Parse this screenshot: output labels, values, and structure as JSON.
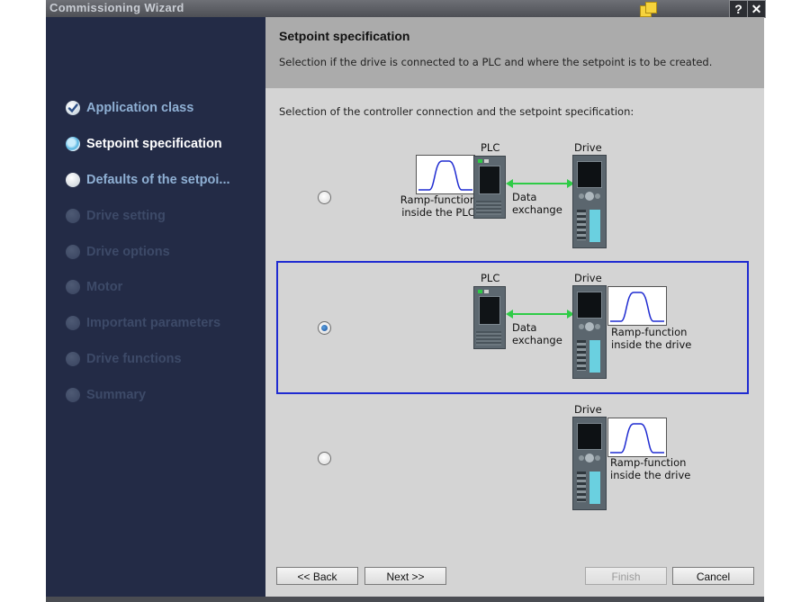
{
  "window": {
    "title": "Commissioning Wizard",
    "help_label": "?",
    "close_label": "✕"
  },
  "steps": [
    {
      "label": "Application class",
      "state": "done"
    },
    {
      "label": "Setpoint specification",
      "state": "current"
    },
    {
      "label": "Defaults of the setpoi...",
      "state": "next"
    },
    {
      "label": "Drive setting",
      "state": "disabled"
    },
    {
      "label": "Drive options",
      "state": "disabled"
    },
    {
      "label": "Motor",
      "state": "disabled"
    },
    {
      "label": "Important parameters",
      "state": "disabled"
    },
    {
      "label": "Drive functions",
      "state": "disabled"
    },
    {
      "label": "Summary",
      "state": "disabled"
    }
  ],
  "header": {
    "title": "Setpoint specification",
    "description": "Selection if the drive is connected to a PLC and where the setpoint is to be created."
  },
  "content": {
    "prompt": "Selection of the controller connection and the setpoint specification:",
    "options": [
      {
        "selected": false,
        "plc_label": "PLC",
        "drive_label": "Drive",
        "ramp_label_line1": "Ramp-function",
        "ramp_label_line2": "inside the PLC",
        "data_label_line1": "Data",
        "data_label_line2": "exchange"
      },
      {
        "selected": true,
        "plc_label": "PLC",
        "drive_label": "Drive",
        "ramp_label_line1": "Ramp-function",
        "ramp_label_line2": "inside the drive",
        "data_label_line1": "Data",
        "data_label_line2": "exchange"
      },
      {
        "selected": false,
        "drive_label": "Drive",
        "ramp_label_line1": "Ramp-function",
        "ramp_label_line2": "inside the drive"
      }
    ]
  },
  "buttons": {
    "back": "<< Back",
    "next": "Next >>",
    "finish": "Finish",
    "cancel": "Cancel"
  },
  "colors": {
    "sidebar_bg": "#232b46",
    "selection_border": "#1f2bd1",
    "arrow_green": "#2ecb46",
    "ramp_curve": "#1f2bd1"
  }
}
